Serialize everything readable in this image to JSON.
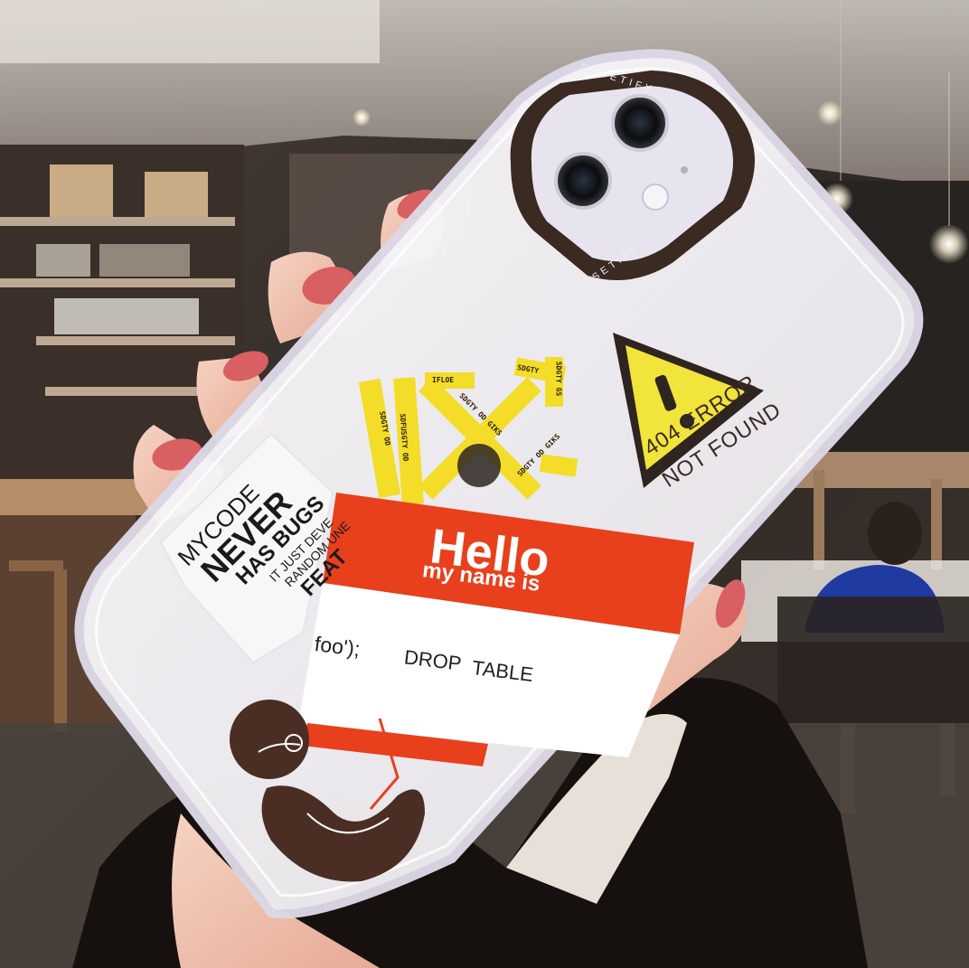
{
  "photo": {
    "colors": {
      "background": "#3b2f28",
      "case_clear": "#f4f2f6",
      "camera_ring": "#3a2a22",
      "hello_red": "#e8401c",
      "tape_yellow": "#f3dd28",
      "warning_yellow": "#f1e43a",
      "dark_brown": "#4a2e24",
      "skin": "#f1c3b0",
      "nail": "#d95c5f"
    }
  },
  "case": {
    "brand_top": "CASETIFY",
    "brand_bottom": "CASETIFY"
  },
  "sticker_mycode": {
    "line1": "MYCODE",
    "line2": "NEVER",
    "line3": "HAS BUGS",
    "line4": "IT JUST DEVE",
    "line5": "RANDOM UNE",
    "line6": "FEAT"
  },
  "sticker_hello": {
    "title": "Hello",
    "subtitle": "my name is",
    "name_line_1": "foo');",
    "name_line_2": "DROP",
    "name_line_3": "TABLE"
  },
  "sticker_error": {
    "line1": "404 ERROR",
    "line2": "NOT FOUND",
    "icon": "warning-triangle-icon"
  },
  "sticker_tape": {
    "labels": [
      "SDGTY OD",
      "SDFUSGTY OD",
      "SDGTY OD GIKS",
      "IFLOE",
      "SDGTY GS",
      "SDGTY OD GIKS",
      "SDGTY"
    ]
  }
}
